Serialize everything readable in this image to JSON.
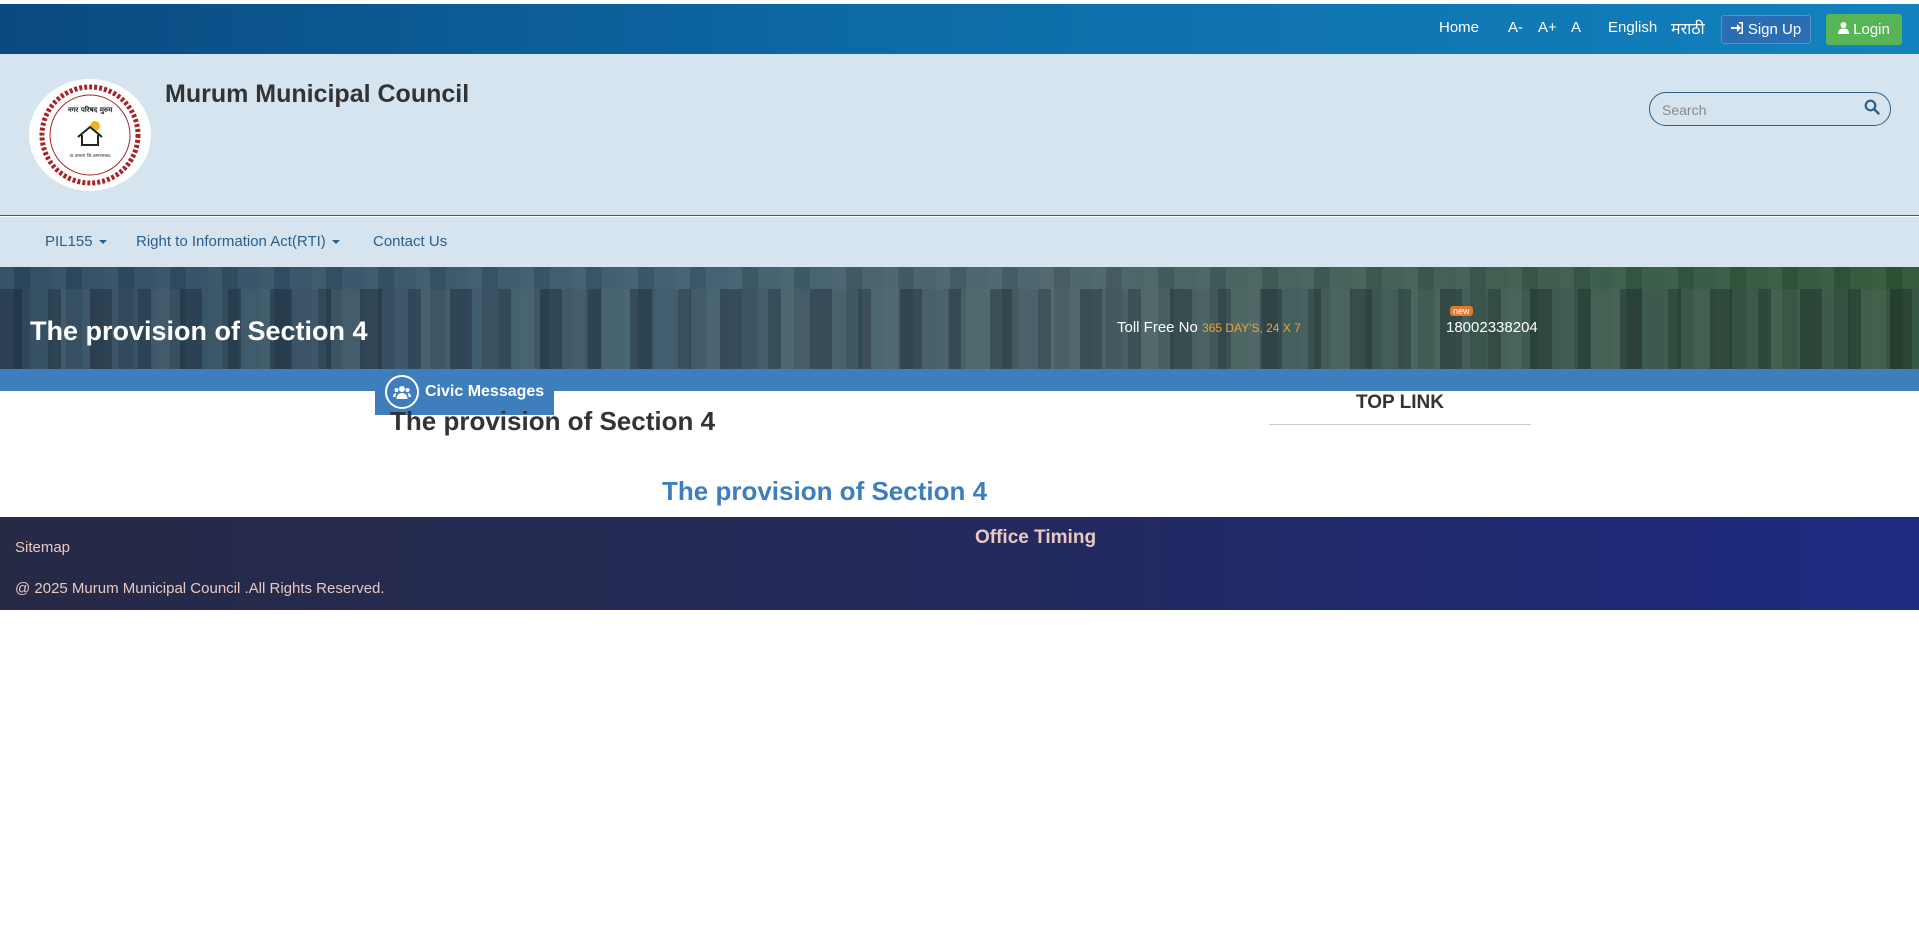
{
  "topbar": {
    "home": "Home",
    "font_decrease": "A-",
    "font_increase": "A+",
    "font_reset": "A",
    "lang_english": "English",
    "lang_marathi": "मराठी",
    "signup": "Sign Up",
    "login": "Login"
  },
  "header": {
    "title": "Murum Municipal Council",
    "logo_text_top": "नगर परिषद मुरुम",
    "logo_text_bottom": "ता.उमरगा जि.उस्मानाबाद",
    "search_placeholder": "Search"
  },
  "nav": {
    "items": [
      {
        "label": "PIL155",
        "dropdown": true
      },
      {
        "label": "Right to Information Act(RTI)",
        "dropdown": true
      },
      {
        "label": "Contact Us",
        "dropdown": false
      }
    ]
  },
  "banner": {
    "title": "The provision of Section 4",
    "toll_label": "Toll Free No",
    "toll_hours": "365 DAY'S, 24 X 7",
    "new_badge": "new",
    "toll_number": "18002338204"
  },
  "civic": {
    "label": "Civic Messages"
  },
  "content": {
    "title": "The provision of Section 4",
    "subtitle": "The provision of Section 4",
    "top_link": "TOP LINK"
  },
  "footer": {
    "sitemap": "Sitemap",
    "office_timing": "Office Timing",
    "copyright": "@ 2025 Murum Municipal Council .All Rights Reserved."
  },
  "colors": {
    "topbar": "#0d6aa6",
    "header_bg": "#d6e4f0",
    "accent_blue": "#3e7ebc",
    "login_green": "#58b557",
    "footer": "#242a5c",
    "toll_hours": "#f0a23c"
  },
  "icons": {
    "signup": "sign-in-icon",
    "login": "user-icon",
    "search": "search-icon",
    "civic": "users-icon"
  }
}
